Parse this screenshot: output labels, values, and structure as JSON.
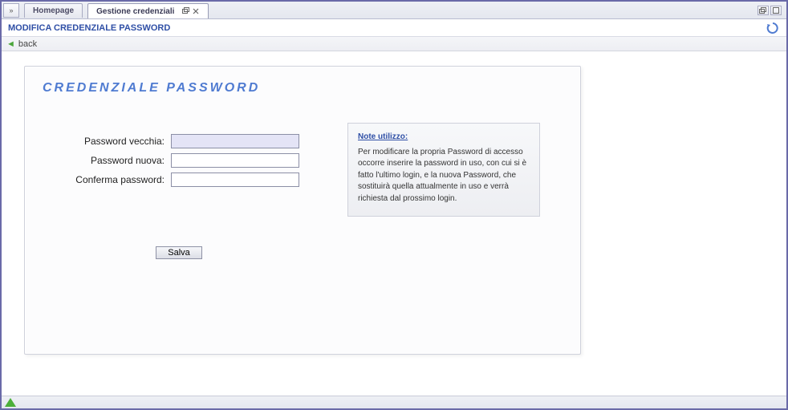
{
  "tabs": {
    "homepage": "Homepage",
    "active": "Gestione credenziali"
  },
  "header": {
    "title": "MODIFICA CREDENZIALE PASSWORD"
  },
  "back": {
    "label": "back"
  },
  "panel": {
    "title": "CREDENZIALE PASSWORD",
    "fields": {
      "old_label": "Password vecchia:",
      "old_value": "",
      "new_label": "Password nuova:",
      "new_value": "",
      "confirm_label": "Conferma password:",
      "confirm_value": ""
    },
    "save_label": "Salva"
  },
  "note": {
    "title": "Note utilizzo:",
    "body": "Per modificare la propria Password di accesso occorre inserire la password in uso, con cui si è fatto l'ultimo login, e la nuova Password, che sostituirà quella attualmente in uso e verrà richiesta dal prossimo login."
  }
}
